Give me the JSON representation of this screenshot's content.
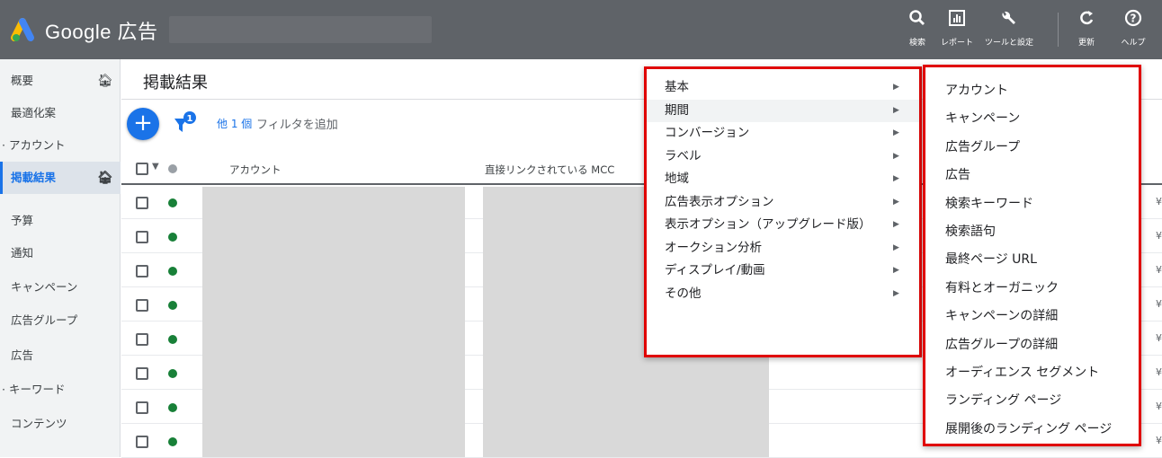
{
  "topbar": {
    "brand": "Google 広告",
    "buttons": [
      {
        "icon": "search-icon",
        "glyph": "Q",
        "label": "検索"
      },
      {
        "icon": "report-icon",
        "glyph": "▣",
        "label": "レポート"
      },
      {
        "icon": "wrench-icon",
        "glyph": "🔧",
        "label": "ツールと設定"
      },
      {
        "icon": "refresh-icon",
        "glyph": "C",
        "label": "更新"
      },
      {
        "icon": "help-icon",
        "glyph": "?",
        "label": "ヘルプ"
      }
    ]
  },
  "sidebar": {
    "items": [
      {
        "label": "概要",
        "home": true
      },
      {
        "label": "最適化案"
      },
      {
        "label": "· アカウント"
      },
      {
        "label": "掲載結果",
        "home": true,
        "active": true
      },
      {
        "label": "予算"
      },
      {
        "label": "通知"
      },
      {
        "label": "キャンペーン"
      },
      {
        "label": "広告グループ"
      },
      {
        "label": "広告"
      },
      {
        "label": "· キーワード"
      },
      {
        "label": "コンテンツ"
      }
    ]
  },
  "main": {
    "title": "掲載結果",
    "add_glyph": "+",
    "filter_count": "1",
    "filter_link": "他 1 個",
    "filter_add": "フィルタを追加",
    "columns": [
      "アカウント",
      "直接リンクされている MCC"
    ],
    "row_count": 8,
    "row_currency": "¥"
  },
  "menu_categories": {
    "items": [
      {
        "label": "基本",
        "arrow": "▶"
      },
      {
        "label": "期間",
        "arrow": "▶",
        "highlighted": true
      },
      {
        "label": "コンバージョン",
        "arrow": "▶"
      },
      {
        "label": "ラベル",
        "arrow": "▶"
      },
      {
        "label": "地域",
        "arrow": "▶"
      },
      {
        "label": "広告表示オプション",
        "arrow": "▶"
      },
      {
        "label": "表示オプション（アップグレード版）",
        "arrow": "▶"
      },
      {
        "label": "オークション分析",
        "arrow": "▶"
      },
      {
        "label": "ディスプレイ/動画",
        "arrow": "▶"
      },
      {
        "label": "その他",
        "arrow": "▶"
      }
    ]
  },
  "menu_levels": {
    "items": [
      "アカウント",
      "キャンペーン",
      "広告グループ",
      "広告",
      "検索キーワード",
      "検索語句",
      "最終ページ URL",
      "有料とオーガニック",
      "キャンペーンの詳細",
      "広告グループの詳細",
      "オーディエンス セグメント",
      "ランディング ページ",
      "展開後のランディング ページ"
    ]
  },
  "colors": {
    "topbar": "#5f6368",
    "accent": "#1a73e8",
    "status_green": "#188038",
    "highlight_border": "#e00000"
  }
}
